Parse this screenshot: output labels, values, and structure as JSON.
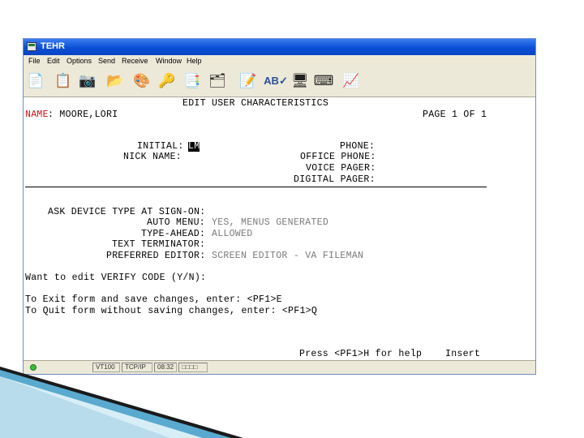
{
  "window": {
    "title": "TEHR"
  },
  "menu": [
    "File",
    "Edit",
    "Options",
    "Send",
    "Receive",
    "Window",
    "Help"
  ],
  "toolbar_icons": [
    "new-document-icon",
    "clipboard-icon",
    "camera-icon",
    "folder-icon",
    "paint-icon",
    "key-icon",
    "copy-icon",
    "hierarchy-icon",
    "notes-icon",
    "spellcheck-icon",
    "computer-icon",
    "keyboard-icon",
    "chart-icon"
  ],
  "screen": {
    "heading": "EDIT USER CHARACTERISTICS",
    "name_label": "NAME",
    "name_value": ": MOORE,LORI",
    "page": "PAGE 1 OF 1",
    "initial_label": "INITIAL:",
    "initial_value": "LM",
    "nick_label": "NICK NAME:",
    "phone_label": "PHONE:",
    "office_phone_label": "OFFICE PHONE:",
    "voice_pager_label": "VOICE PAGER:",
    "digital_pager_label": "DIGITAL PAGER:",
    "ask_device_label": "ASK DEVICE TYPE AT SIGN-ON:",
    "auto_menu_label": "AUTO MENU:",
    "auto_menu_value": "YES, MENUS GENERATED",
    "type_ahead_label": "TYPE-AHEAD:",
    "type_ahead_value": "ALLOWED",
    "text_terminator_label": "TEXT TERMINATOR:",
    "preferred_editor_label": "PREFERRED EDITOR:",
    "preferred_editor_value": "SCREEN EDITOR - VA FILEMAN",
    "verify_prompt": "Want to edit VERIFY CODE (Y/N):",
    "exit_line": "To Exit form and save changes, enter: <PF1>E",
    "quit_line": "To Quit form without saving changes, enter: <PF1>Q",
    "help_line": "Press <PF1>H for help",
    "mode": "Insert"
  },
  "status": {
    "terminal": "VT100",
    "protocol": "TCP/IP",
    "time": "08:32",
    "blocks": "□□□□"
  },
  "colors": {
    "titlebar": "#0a4fd6",
    "label_red": "#d21010",
    "value_grey": "#7a7a7a"
  }
}
